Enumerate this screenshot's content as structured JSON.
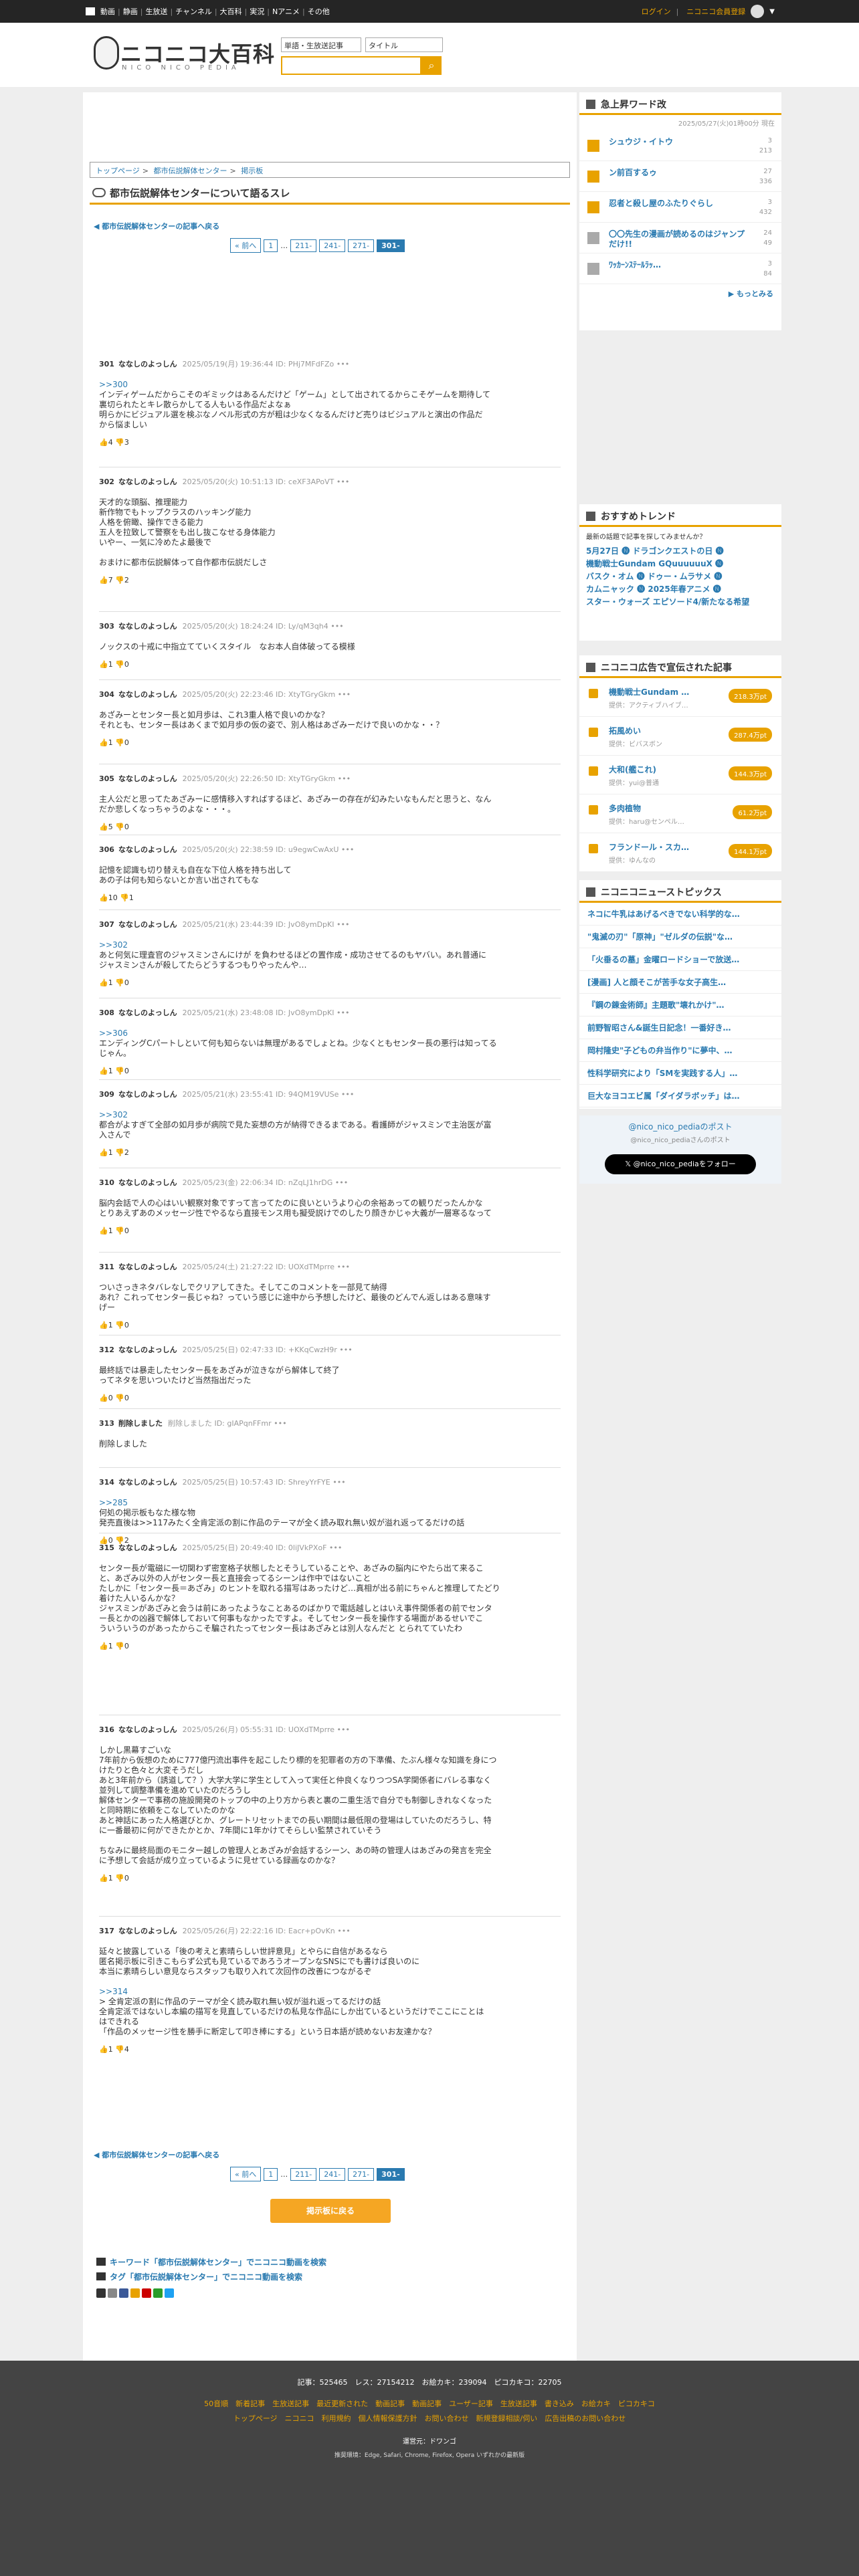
{
  "topbar": {
    "items": [
      "動画",
      "静画",
      "生放送",
      "チャンネル",
      "大百科",
      "実況",
      "Nアニメ",
      "その他"
    ],
    "login": "ログイン",
    "register": "ニコニコ会員登録"
  },
  "header": {
    "logo": "ニコニコ大百科",
    "logo_sub": "NICO NICO PEDIA",
    "select1": "単語・生放送記事",
    "select2": "タイトル"
  },
  "breadcrumb": [
    "トップページ",
    "都市伝説解体センター",
    "掲示板"
  ],
  "page_title": "都市伝説解体センターについて語るスレ",
  "back_label": "◀ 都市伝説解体センターの記事へ戻る",
  "pager": {
    "prev": "« 前へ",
    "first": "1",
    "dots": "…",
    "pages": [
      "211-",
      "241-",
      "271-"
    ],
    "current": "301-"
  },
  "posts": [
    {
      "num": "301",
      "name": "ななしのよっしん",
      "date": "2025/05/19(月) 19:36:44 ID: PHj7MFdFZo",
      "lines": [
        ">>300",
        "インディゲームだからこそのギミックはあるんだけど「ゲーム」として出されてるからこそゲームを期待して",
        "裏切られたとキレ散らかしてる人もいる作品だよなぁ",
        "明らかにビジュアル選を検ぶなノベル形式の方が粗は少なくなるんだけど売りはビジュアルと演出の作品だ",
        "から悩ましい"
      ],
      "votes": "👍4 👎3"
    },
    {
      "num": "302",
      "name": "ななしのよっしん",
      "date": "2025/05/20(火) 10:51:13 ID: ceXF3APoVT",
      "lines": [
        "天才的な頭脳、推理能力",
        "新作物でもトップクラスのハッキング能力",
        "人格を俯瞰、操作できる能力",
        "五人を拉致して警察をも出し抜こなせる身体能力",
        "いやー、一気に冷めたよ最後で",
        "",
        "おまけに都市伝説解体って自作都市伝説だしさ"
      ],
      "votes": "👍7 👎2"
    },
    {
      "num": "303",
      "name": "ななしのよっしん",
      "date": "2025/05/20(火) 18:24:24 ID: Ly/qM3qh4",
      "lines": [
        "ノックスの十戒に中指立てていくスタイル　なお本人自体破ってる模様"
      ],
      "votes": "👍1 👎0"
    },
    {
      "num": "304",
      "name": "ななしのよっしん",
      "date": "2025/05/20(火) 22:23:46 ID: XtyTGryGkm",
      "lines": [
        "あざみーとセンター長と如月歩は、これ3重人格で良いのかな？",
        "それとも、センター長はあくまで如月歩の仮の姿で、別人格はあざみーだけで良いのかな・・？"
      ],
      "votes": "👍1 👎0"
    },
    {
      "num": "305",
      "name": "ななしのよっしん",
      "date": "2025/05/20(火) 22:26:50 ID: XtyTGryGkm",
      "lines": [
        "主人公だと思ってたあざみーに感情移入すればするほど、あざみーの存在が幻みたいなもんだと思うと、なん",
        "だか悲しくなっちゃうのよな・・・。"
      ],
      "votes": "👍5 👎0"
    },
    {
      "num": "306",
      "name": "ななしのよっしん",
      "date": "2025/05/20(火) 22:38:59 ID: u9egwCwAxU",
      "lines": [
        "記憶を認識も切り替えも自在な下位人格を持ち出して",
        "あの子は何も知らないとか言い出されてもな"
      ],
      "votes": "👍10 👎1"
    },
    {
      "num": "307",
      "name": "ななしのよっしん",
      "date": "2025/05/21(水) 23:44:39 ID: JvO8ymDpKI",
      "lines": [
        ">>302",
        "あと何気に理査官のジャスミンさんにけが を負わせるほどの置作成・成功させてるのもヤバい。あれ普通に",
        "ジャスミンさんが殺してたらどうするつもりやったんや…"
      ],
      "votes": "👍1 👎0"
    },
    {
      "num": "308",
      "name": "ななしのよっしん",
      "date": "2025/05/21(水) 23:48:08 ID: JvO8ymDpKI",
      "lines": [
        ">>306",
        "エンディングCパートしといて何も知らないは無理があるでしょとね。少なくともセンター長の悪行は知ってる",
        "じゃん。"
      ],
      "votes": "👍1 👎0"
    },
    {
      "num": "309",
      "name": "ななしのよっしん",
      "date": "2025/05/21(水) 23:55:41 ID: 94QM19VUSe",
      "lines": [
        ">>302",
        "都合がよすぎて全部の如月歩が病院で見た妄想の方が納得できるまである。看護師がジャスミンで主治医が富",
        "入さんで"
      ],
      "votes": "👍1 👎2"
    },
    {
      "num": "310",
      "name": "ななしのよっしん",
      "date": "2025/05/23(金) 22:06:34 ID: nZqLJ1hrDG",
      "lines": [
        "脳内会話で人の心はいい観察対象ですって言ってたのに良いというより心の余裕あっての観りだったんかな",
        "とりあえずあのメッセージ性でやるなら直接モンス用も擬受説けでのしたり顔きかじゃ大義が一層寒るなって"
      ],
      "votes": "👍1 👎0"
    },
    {
      "num": "311",
      "name": "ななしのよっしん",
      "date": "2025/05/24(土) 21:27:22 ID: UOXdTMprre",
      "lines": [
        "ついさっきネタバレなしでクリアしてきた。そしてこのコメントを一部見て納得",
        "あれ？これってセンター長じゃね？っていう感じに途中から予想したけど、最後のどんでん返しはある意味す",
        "げー"
      ],
      "votes": "👍1 👎0"
    },
    {
      "num": "312",
      "name": "ななしのよっしん",
      "date": "2025/05/25(日) 02:47:33 ID: +KKqCwzH9r",
      "lines": [
        "最終話では暴走したセンター長をあざみが泣きながら解体して終了",
        "ってネタを思いついたけど当然指出だった"
      ],
      "votes": "👍0 👎0"
    },
    {
      "num": "313",
      "name": "削除しました",
      "date": "削除しました ID: gIAPqnFFmr",
      "lines": [
        "削除しました"
      ],
      "votes": ""
    },
    {
      "num": "314",
      "name": "ななしのよっしん",
      "date": "2025/05/25(日) 10:57:43 ID: ShreyYrFYE",
      "lines": [
        ">>285",
        "何処の掲示板もなた様な物",
        "発売直後は>>117みたく全肯定派の割に作品のテーマが全く読み取れ無い奴が溢れ返ってるだけの話"
      ],
      "votes": "👍0 👎2"
    },
    {
      "num": "315",
      "name": "ななしのよっしん",
      "date": "2025/05/25(日) 20:49:40 ID: 0liJVkPXoF",
      "lines": [
        "センター長が電磁に一切関わず密室格子状態したとそうしていることや、あざみの脳内にやたら出て来るこ",
        "と、あざみ以外の人がセンター長と直接会ってるシーンは作中ではないこと",
        "たしかに「センター長＝あざみ」のヒントを取れる描写はあったけど…真相が出る前にちゃんと推理してたどり",
        "着けた人いるんかな？",
        "ジャスミンがあざみと会うは前にあったようなことあるのばかりで電話越しとはいえ事件関係者の前でセンタ",
        "ー長とかの凶器で解体しておいて何事もなかったですよ。そしてセンター長を操作する場面があるせいでこ",
        "ういういうのがあったからこそ騙されたってセンター長はあざみとは別人なんだと とられてていたわ"
      ],
      "votes": "👍1 👎0"
    },
    {
      "num": "316",
      "name": "ななしのよっしん",
      "date": "2025/05/26(月) 05:55:31 ID: UOXdTMprre",
      "lines": [
        "しかし黒幕すごいな",
        "7年前から仮想のために777億円流出事件を起こしたり標的を犯罪者の方の下準備、たぶん様々な知識を身につ",
        "けたりと色々と大変そうだし",
        "あと3年前から（誘道して？）大学大学に学生として入って実任と仲良くなりつつSA学関係者にバレる事なく",
        "並列して調整準備を進めていたのだろうし",
        "解体センターで事務の施設開発のトップの中の上り方から表と裏の二重生活で自分でも制御しきれなくなった",
        "と同時期に依頼をこなしていたのかな",
        "あと神話にあった人格選びとか、グレートリセットまでの長い期間は最低限の登場はしていたのだろうし、特",
        "に一番最初に何ができたかとか、7年間に1年かけてそらしい監禁されていそう",
        "",
        "ちなみに最終局面のモニター越しの管理人とあざみが会話するシーン、あの時の管理人はあざみの発言を完全",
        "に予想して会話が成り立っているように見せている録画なのかな？"
      ],
      "votes": "👍1 👎0"
    },
    {
      "num": "317",
      "name": "ななしのよっしん",
      "date": "2025/05/26(月) 22:22:16 ID: Eacr+pOvKn",
      "lines": [
        "延々と披露している「後の考えと素晴らしい世評意見」とやらに自信があるなら",
        "匿名掲示板に引きこもらず公式も見ているであろうオープンなSNSにでも書けば良いのに",
        "本当に素晴らしい意見ならスタッフも取り入れて次回作の改善につながるぞ",
        "",
        ">>314",
        "> 全肯定派の割に作品のテーマが全く読み取れ無い奴が溢れ返ってるだけの話",
        "全肯定派ではないし本編の描写を見直しているだけの私見な作品にしか出ているというだけでここにことは",
        "はできれる",
        "「作品のメッセージ性を勝手に断定して叩き棒にする」という日本語が読めないお友達かな？"
      ],
      "votes": "👍1 👎4"
    }
  ],
  "bottom_cta": "掲示板に戻る",
  "keyword_links": [
    "キーワード「都市伝説解体センター」でニコニコ動画を検索",
    "タグ「都市伝説解体センター」でニコニコ動画を検索"
  ],
  "sidebar": {
    "rank_title": "急上昇ワード改",
    "rank_date": "2025/05/27(火)01時00分 現在",
    "rank_items": [
      {
        "title": "シュウジ・イトウ",
        "s1": "3",
        "s2": "213"
      },
      {
        "title": "ン前百するゥ",
        "s1": "27",
        "s2": "336"
      },
      {
        "title": "忍者と殺し屋のふたりぐらし",
        "s1": "3",
        "s2": "432"
      },
      {
        "title": "〇〇先生の漫画が読めるのはジャンプだけ!!",
        "s1": "24",
        "s2": "49"
      },
      {
        "title": "ﾜｯｶｰﾝｽﾃｰﾙﾗｯ…",
        "s1": "3",
        "s2": "84"
      }
    ],
    "more": "▶ もっとみる",
    "trend_title": "おすすめトレンド",
    "trend_note": "最新の話題で記事を探してみませんか？",
    "trend_items": [
      "5月27日 🅝 ドラゴンクエストの日 🅝",
      "機動戦士Gundam GQuuuuuuX 🅝",
      "バスク・オム 🅝 ドゥー・ムラサメ 🅝",
      "カムニャック 🅝 2025年春アニメ 🅝",
      "スター・ウォーズ エピソード4/新たなる希望"
    ],
    "ad_title": "ニコニコ広告で宣伝された記事",
    "ad_items": [
      {
        "title": "機動戦士Gundam …",
        "sub": "提供：アクティブハイブ…",
        "badge": "218.3万pt"
      },
      {
        "title": "拓風めい",
        "sub": "提供：ビバスボン",
        "badge": "287.4万pt"
      },
      {
        "title": "大和(艦これ)",
        "sub": "提供：yui@普通",
        "badge": "144.3万pt"
      },
      {
        "title": "多肉植物",
        "sub": "提供：haru@センペル…",
        "badge": "61.2万pt"
      },
      {
        "title": "フランドール・スカ…",
        "sub": "提供：ゆんなの",
        "badge": "144.1万pt"
      }
    ],
    "topics_title": "ニコニコニューストピックス",
    "topics": [
      "ネコに牛乳はあげるべきでない科学的な…",
      "\"鬼滅の刃\"「原神」\"ゼルダの伝説\"な…",
      "「火垂るの墓」金曜ロードショーで放送…",
      "[漫画] 人と顔そこが苦手な女子高生…",
      "『鋼の錬金術師』主題歌\"壊れかけ\"…",
      "前野智昭さん&誕生日記念！一番好き…",
      "岡村隆史\"子どもの弁当作り\"に夢中、…",
      "性科学研究により「SMを実践する人」…",
      "巨大なヨコエビ属「ダイダラボッチ」は…"
    ],
    "x_title": "@nico_nico_pediaのポスト",
    "x_sub": "@nico_nico_pediaさんのポスト",
    "x_btn": "@nico_nico_pediaをフォロー"
  },
  "footer": {
    "stats": "記事：525465　レス：27154212　お絵カキ：239094　ピコカキコ：22705",
    "links1": "50音順　新着記事　生放送記事　最近更新された　動画記事　動画記事　ユーザー記事　生放送記事　書き込み　お絵カキ　ピコカキコ",
    "links2": "トップページ　ニコニコ　利用規約　個人情報保護方針　お問い合わせ　新規登録相談/伺い　広告出稿のお問い合わせ",
    "operator": "運営元：ドワンゴ",
    "recommend": "推奨環境：Edge, Safari, Chrome, Firefox, Opera いずれかの最新版"
  }
}
